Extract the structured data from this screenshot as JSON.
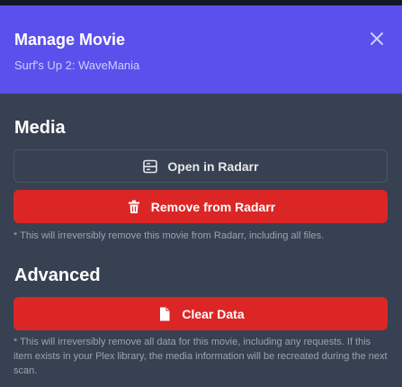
{
  "modal": {
    "title": "Manage Movie",
    "subtitle": "Surf's Up 2: WaveMania"
  },
  "media": {
    "heading": "Media",
    "open_label": "Open in Radarr",
    "remove_label": "Remove from Radarr",
    "remove_note": "* This will irreversibly remove this movie from Radarr, including all files."
  },
  "advanced": {
    "heading": "Advanced",
    "clear_label": "Clear Data",
    "clear_note": "* This will irreversibly remove all data for this movie, including any requests. If this item exists in your Plex library, the media information will be recreated during the next scan."
  },
  "icons": {
    "close": "close-icon",
    "open": "server-icon",
    "remove": "trash-icon",
    "clear": "document-icon"
  },
  "colors": {
    "header": "#5b50ec",
    "danger": "#dc2626",
    "panel": "#374151"
  }
}
